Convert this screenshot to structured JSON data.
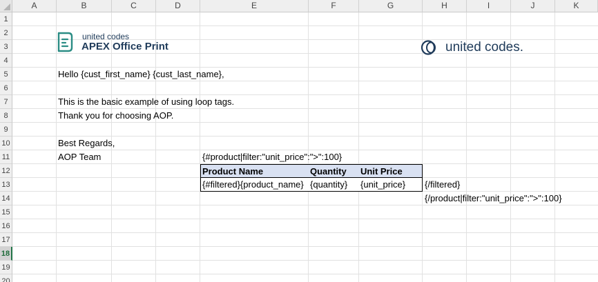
{
  "columns": [
    "A",
    "B",
    "C",
    "D",
    "E",
    "F",
    "G",
    "H",
    "I",
    "J",
    "K"
  ],
  "rows": [
    "1",
    "2",
    "3",
    "4",
    "5",
    "6",
    "7",
    "8",
    "9",
    "10",
    "11",
    "12",
    "13",
    "14",
    "15",
    "16",
    "17",
    "18",
    "19",
    "20"
  ],
  "selected_row": "18",
  "logos": {
    "aop_small": "united codes",
    "aop_big": "APEX Office Print",
    "aop_icon": "aop-document-icon",
    "uc_text": "united codes.",
    "uc_icon": "united-codes-rings-icon",
    "brand_color": "#1f3b5a"
  },
  "cells": {
    "greeting": "Hello {cust_first_name} {cust_last_name},",
    "line1": "This is the basic example of using loop tags.",
    "line2": "Thank you for choosing AOP.",
    "regards": "Best Regards,",
    "team": "AOP Team",
    "loop_open": "{#product|filter:\"unit_price\":\">\":100}",
    "filtered_close": "{/filtered}",
    "loop_close": "{/product|filter:\"unit_price\":\">\":100}"
  },
  "table": {
    "header_color": "#d9e1f2",
    "headers": [
      "Product Name",
      "Quantity",
      "Unit Price"
    ],
    "row": [
      "{#filtered}{product_name}",
      "{quantity}",
      "{unit_price}"
    ]
  }
}
